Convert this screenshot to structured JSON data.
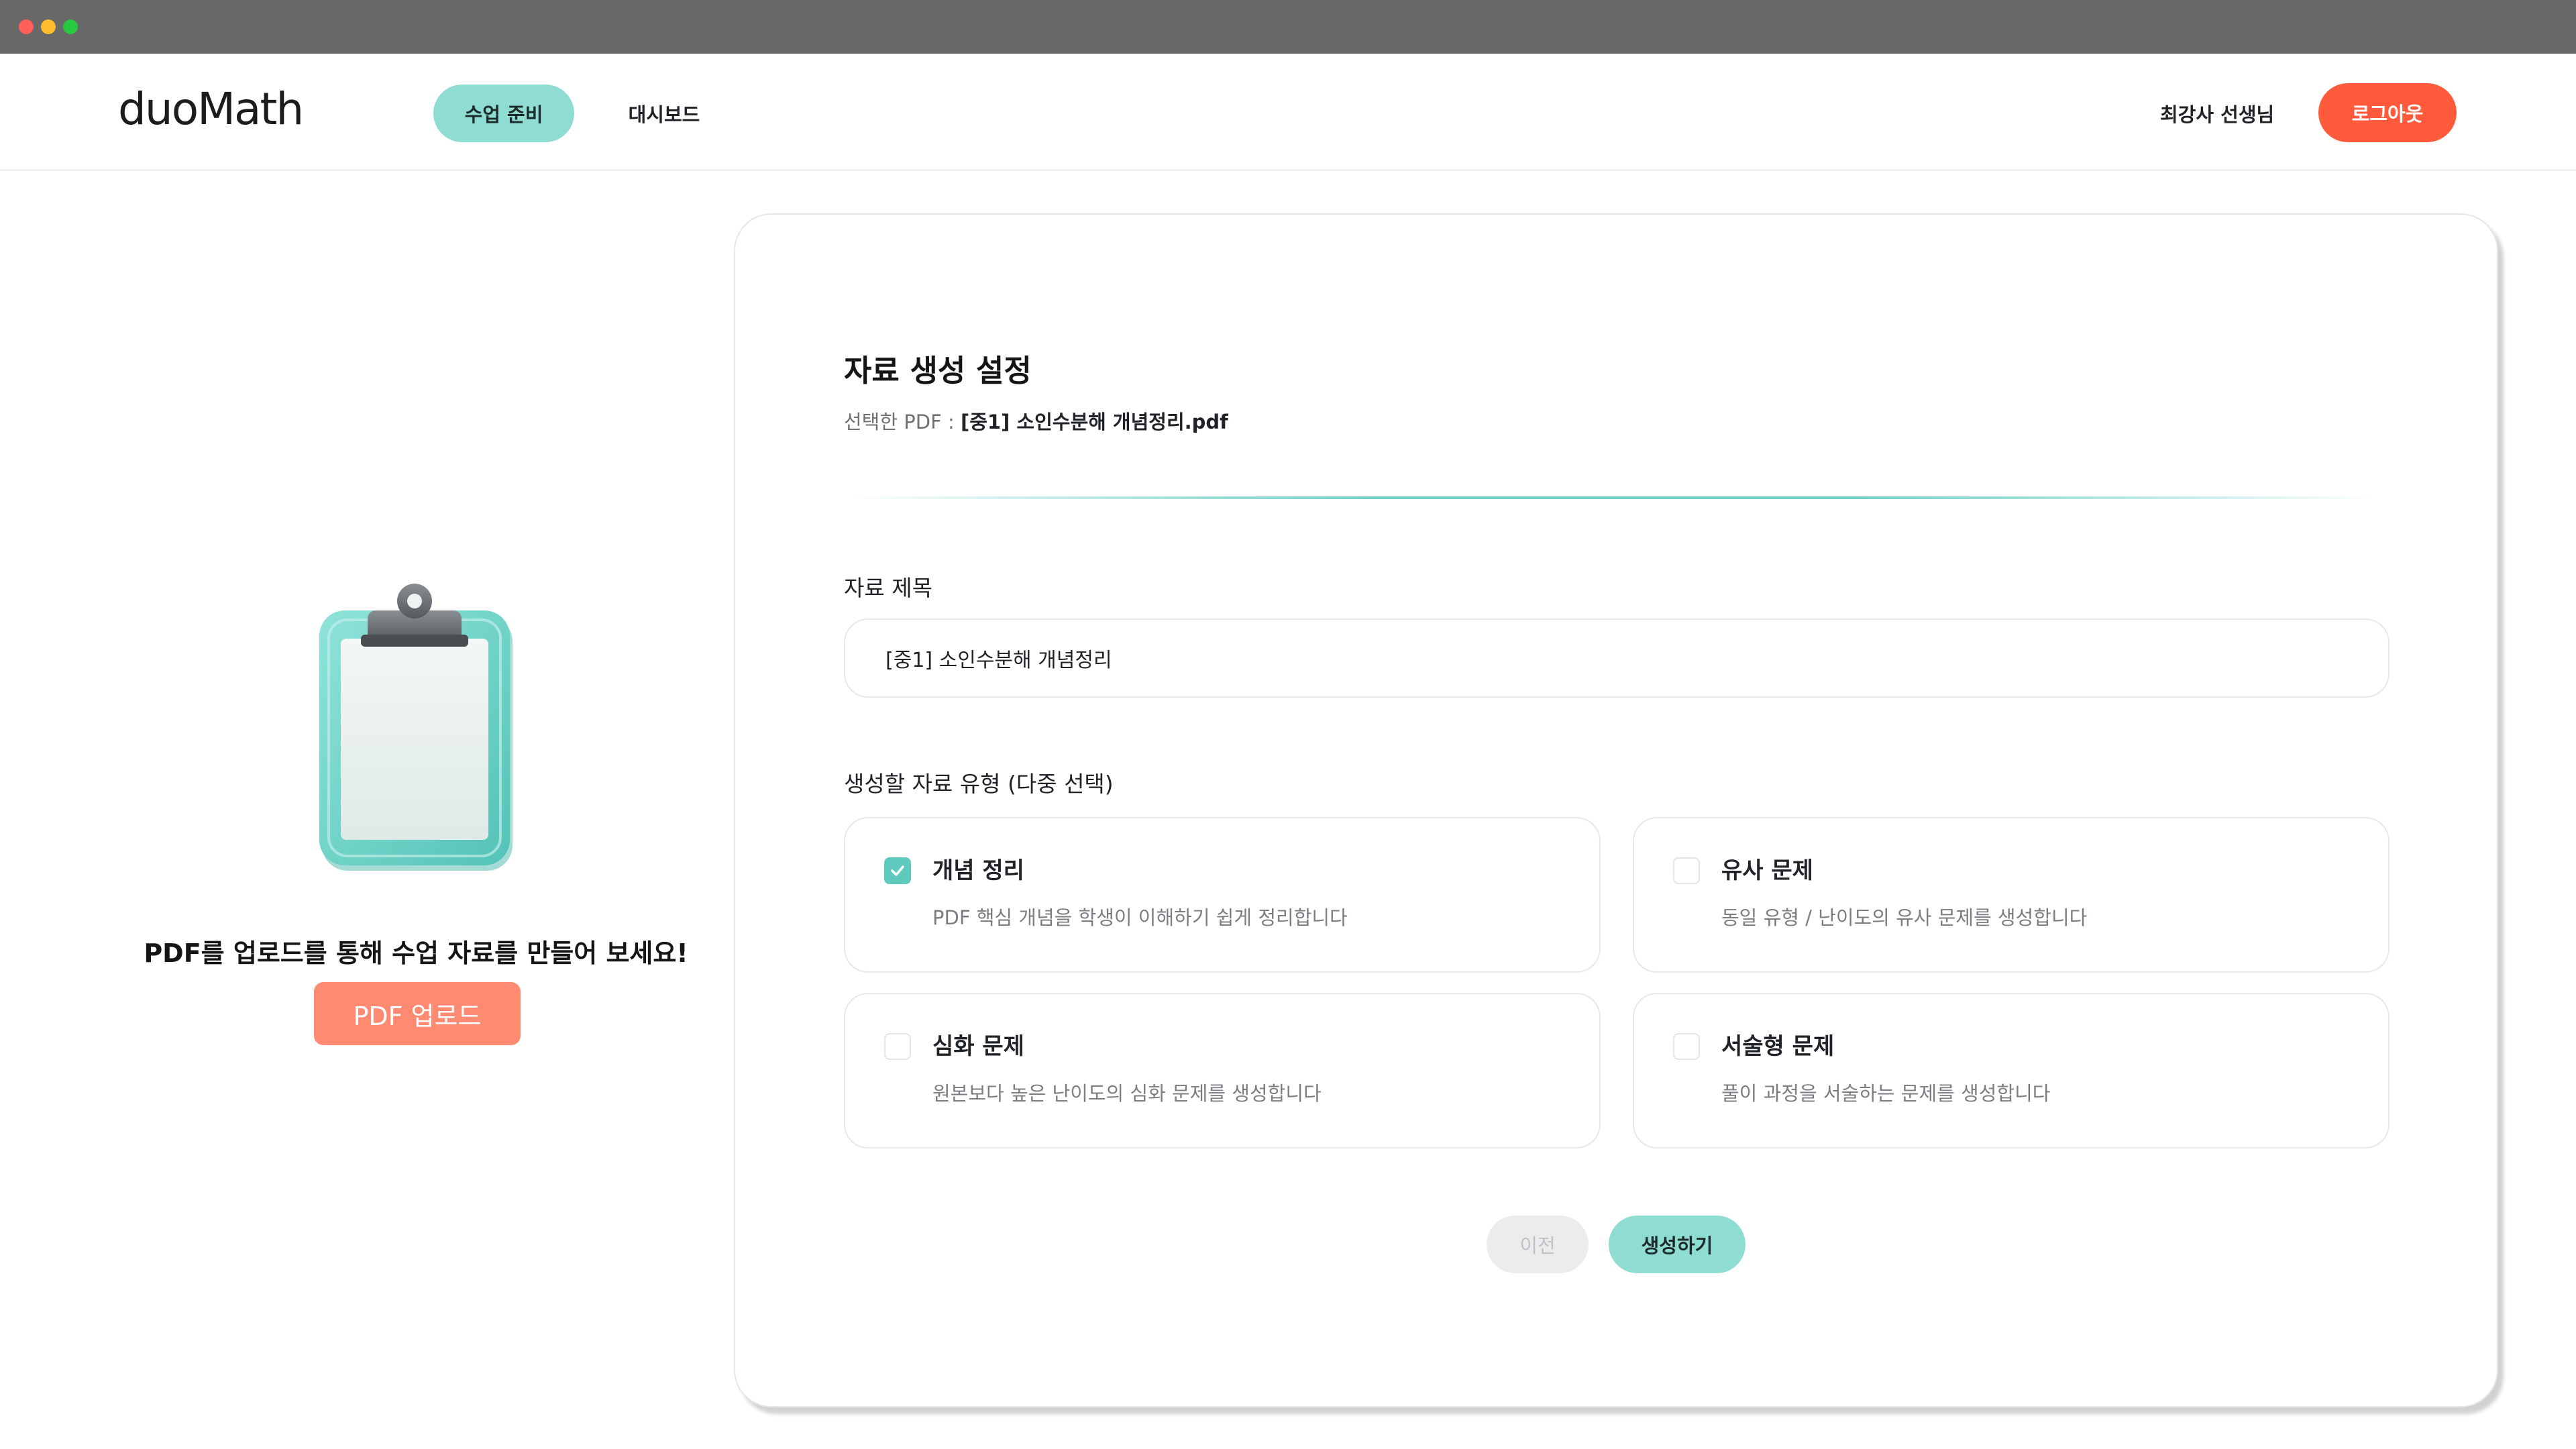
{
  "window": {
    "controls": [
      "close-dot",
      "minimize-dot",
      "maximize-dot"
    ]
  },
  "header": {
    "logo": "duoMath",
    "nav": [
      {
        "label": "수업 준비",
        "active": true
      },
      {
        "label": "대시보드",
        "active": false
      }
    ],
    "user_name": "최강사 선생님",
    "logout_label": "로그아웃"
  },
  "upload_panel": {
    "icon": "clipboard-icon",
    "prompt": "PDF를 업로드를 통해 수업 자료를 만들어 보세요!",
    "button_label": "PDF 업로드"
  },
  "settings": {
    "title": "자료 생성 설정",
    "selected_pdf_label": "선택한 PDF : ",
    "selected_pdf_name": "[중1] 소인수분해 개념정리.pdf",
    "material_title_label": "자료 제목",
    "material_title_value": "[중1] 소인수분해 개념정리",
    "types_label": "생성할 자료 유형 (다중 선택)",
    "options": [
      {
        "title": "개념 정리",
        "description": "PDF 핵심 개념을 학생이 이해하기 쉽게 정리합니다",
        "checked": true
      },
      {
        "title": "유사 문제",
        "description": "동일 유형 / 난이도의 유사 문제를 생성합니다",
        "checked": false
      },
      {
        "title": "심화 문제",
        "description": "원본보다 높은 난이도의 심화 문제를 생성합니다",
        "checked": false
      },
      {
        "title": "서술형 문제",
        "description": "풀이 과정을 서술하는 문제를 생성합니다",
        "checked": false
      }
    ],
    "prev_label": "이전",
    "create_label": "생성하기"
  },
  "colors": {
    "accent_teal": "#8fdcd3",
    "checkbox_teal": "#5ec9bd",
    "logout_red": "#ff5a3c",
    "upload_salmon": "#ff8a72"
  }
}
